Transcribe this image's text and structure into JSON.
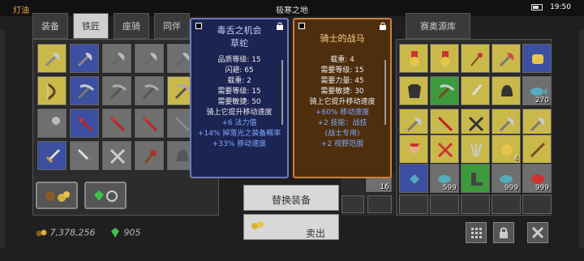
{
  "status": {
    "left": "灯油",
    "title": "极寒之地",
    "time": "19:50"
  },
  "tabs": [
    {
      "label": "装备"
    },
    {
      "label": "铁匠"
    },
    {
      "label": "座骑"
    },
    {
      "label": "同伴"
    },
    {
      "label": "炼金术"
    },
    {
      "label": "神秘"
    },
    {
      "label": "背包"
    },
    {
      "label": "宝箱"
    },
    {
      "label": "赛奥源库"
    }
  ],
  "tooltip_left": {
    "title": "毒舌之机会",
    "subtitle": "草蛇",
    "lines": [
      "品质等级: 15",
      "闪避: 65",
      "载重: 2",
      "需要等级: 15",
      "需要敏捷: 50",
      "骑上它提升移动速度"
    ],
    "bonuses": [
      "+6 法力值",
      "+14% 掉落光之装备概率",
      "+33% 移动速度"
    ]
  },
  "tooltip_right": {
    "title": "骑士的战马",
    "lines": [
      "载重: 4",
      "需要等级: 15",
      "需要力量: 45",
      "需要敏捷: 30",
      "骑上它提升移动速度"
    ],
    "bonuses": [
      "+60% 移动速度",
      "+2 技能：战技",
      "(战士专用)",
      "+2 视野范围"
    ]
  },
  "popup": {
    "swap_label": "替换装备",
    "sell_label": "卖出"
  },
  "currency": {
    "gold": "7,378,256",
    "gems": "905"
  },
  "stack_counts": {
    "c270": "270",
    "c4": "4",
    "c16": "16",
    "c599": "599",
    "c999a": "999",
    "c999b": "999"
  },
  "colors": {
    "tooltip_blue_bg": "#1c2452",
    "tooltip_brown_bg": "#4e2e0d",
    "bonus_text": "#7fa8ff",
    "quality_yellow": "#c9b84a",
    "quality_blue": "#3c4fa0"
  }
}
